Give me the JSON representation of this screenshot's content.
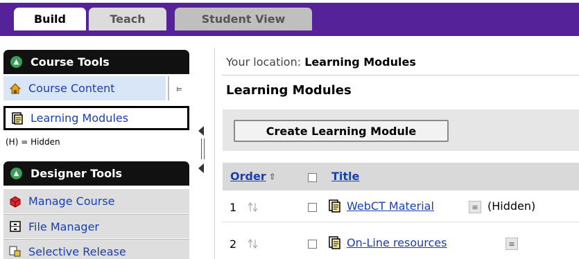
{
  "tabs": [
    {
      "label": "Build"
    },
    {
      "label": "Teach"
    },
    {
      "label": "Student View"
    }
  ],
  "sidebar": {
    "course_tools": {
      "title": "Course Tools",
      "items": [
        {
          "label": "Course Content"
        },
        {
          "label": "Learning Modules"
        }
      ],
      "hidden_note": "(H) = Hidden"
    },
    "designer_tools": {
      "title": "Designer Tools",
      "items": [
        {
          "label": "Manage Course"
        },
        {
          "label": "File Manager"
        },
        {
          "label": "Selective Release"
        }
      ]
    }
  },
  "main": {
    "location_prefix": "Your location:",
    "location_value": "Learning Modules",
    "page_title": "Learning Modules",
    "create_button": "Create Learning Module",
    "table": {
      "order_header": "Order",
      "title_header": "Title",
      "rows": [
        {
          "order": "1",
          "title": "WebCT Material",
          "status": "(Hidden)"
        },
        {
          "order": "2",
          "title": "On-Line resources",
          "status": ""
        }
      ]
    }
  },
  "colors": {
    "brand": "#56229a",
    "link": "#1a3fae",
    "section_header": "#111111",
    "section_icon": "#3aa055",
    "table_header_bg": "#d9d9d9"
  },
  "icons": {
    "collapse": "double-chevron-up-icon",
    "expand": "double-chevron-down-icon",
    "home": "house-icon",
    "document": "document-icon",
    "manage": "cube-icon",
    "file_manager": "file-manager-icon",
    "release": "selective-release-icon",
    "sort": "sort-arrow-icon",
    "reorder": "reorder-icon",
    "menu": "context-menu-icon"
  }
}
